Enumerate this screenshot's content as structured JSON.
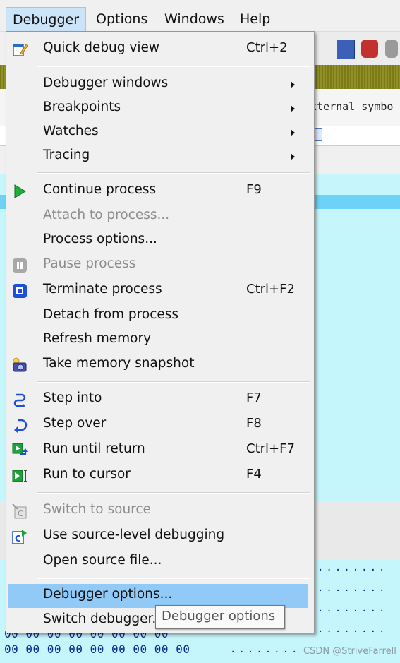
{
  "menubar": {
    "items": [
      {
        "label": "Debugger"
      },
      {
        "label": "Options"
      },
      {
        "label": "Windows"
      },
      {
        "label": "Help"
      }
    ]
  },
  "background": {
    "external_symbols_text": "xternal symbo",
    "hex_row": "00 00 00 00 00 00 00 00",
    "hex_row_partial": "00 00 00 00 00 00 00 00 00",
    "dots": "........",
    "watermark": "CSDN @StriveFarrell"
  },
  "menu": {
    "items": [
      {
        "label": "Quick debug view",
        "shortcut": "Ctrl+2",
        "icon": "quick-debug-view-icon",
        "enabled": true
      },
      {
        "label": "Debugger windows",
        "submenu": true,
        "enabled": true
      },
      {
        "label": "Breakpoints",
        "submenu": true,
        "enabled": true
      },
      {
        "label": "Watches",
        "submenu": true,
        "enabled": true
      },
      {
        "label": "Tracing",
        "submenu": true,
        "enabled": true
      },
      {
        "label": "Continue process",
        "shortcut": "F9",
        "icon": "play-icon",
        "enabled": true
      },
      {
        "label": "Attach to process...",
        "enabled": false
      },
      {
        "label": "Process options...",
        "enabled": true
      },
      {
        "label": "Pause process",
        "icon": "pause-icon",
        "enabled": false
      },
      {
        "label": "Terminate process",
        "shortcut": "Ctrl+F2",
        "icon": "stop-icon",
        "enabled": true
      },
      {
        "label": "Detach from process",
        "enabled": true
      },
      {
        "label": "Refresh memory",
        "enabled": true
      },
      {
        "label": "Take memory snapshot",
        "icon": "camera-icon",
        "enabled": true
      },
      {
        "label": "Step into",
        "shortcut": "F7",
        "icon": "step-into-icon",
        "enabled": true
      },
      {
        "label": "Step over",
        "shortcut": "F8",
        "icon": "step-over-icon",
        "enabled": true
      },
      {
        "label": "Run until return",
        "shortcut": "Ctrl+F7",
        "icon": "run-until-return-icon",
        "enabled": true
      },
      {
        "label": "Run to cursor",
        "shortcut": "F4",
        "icon": "run-to-cursor-icon",
        "enabled": true
      },
      {
        "label": "Switch to source",
        "icon": "switch-source-icon",
        "enabled": false
      },
      {
        "label": "Use source-level debugging",
        "icon": "source-debug-icon",
        "enabled": true
      },
      {
        "label": "Open source file...",
        "enabled": true
      },
      {
        "label": "Debugger options...",
        "enabled": true,
        "selected": true
      },
      {
        "label": "Switch debugger...",
        "enabled": true
      }
    ]
  },
  "tooltip": {
    "text": "Debugger options"
  },
  "colors": {
    "menu_selection": "#91c9f7",
    "code_background": "#c5f6fb",
    "highlight_row": "#6dd2f5",
    "disabled_text": "#8c8c8c"
  }
}
